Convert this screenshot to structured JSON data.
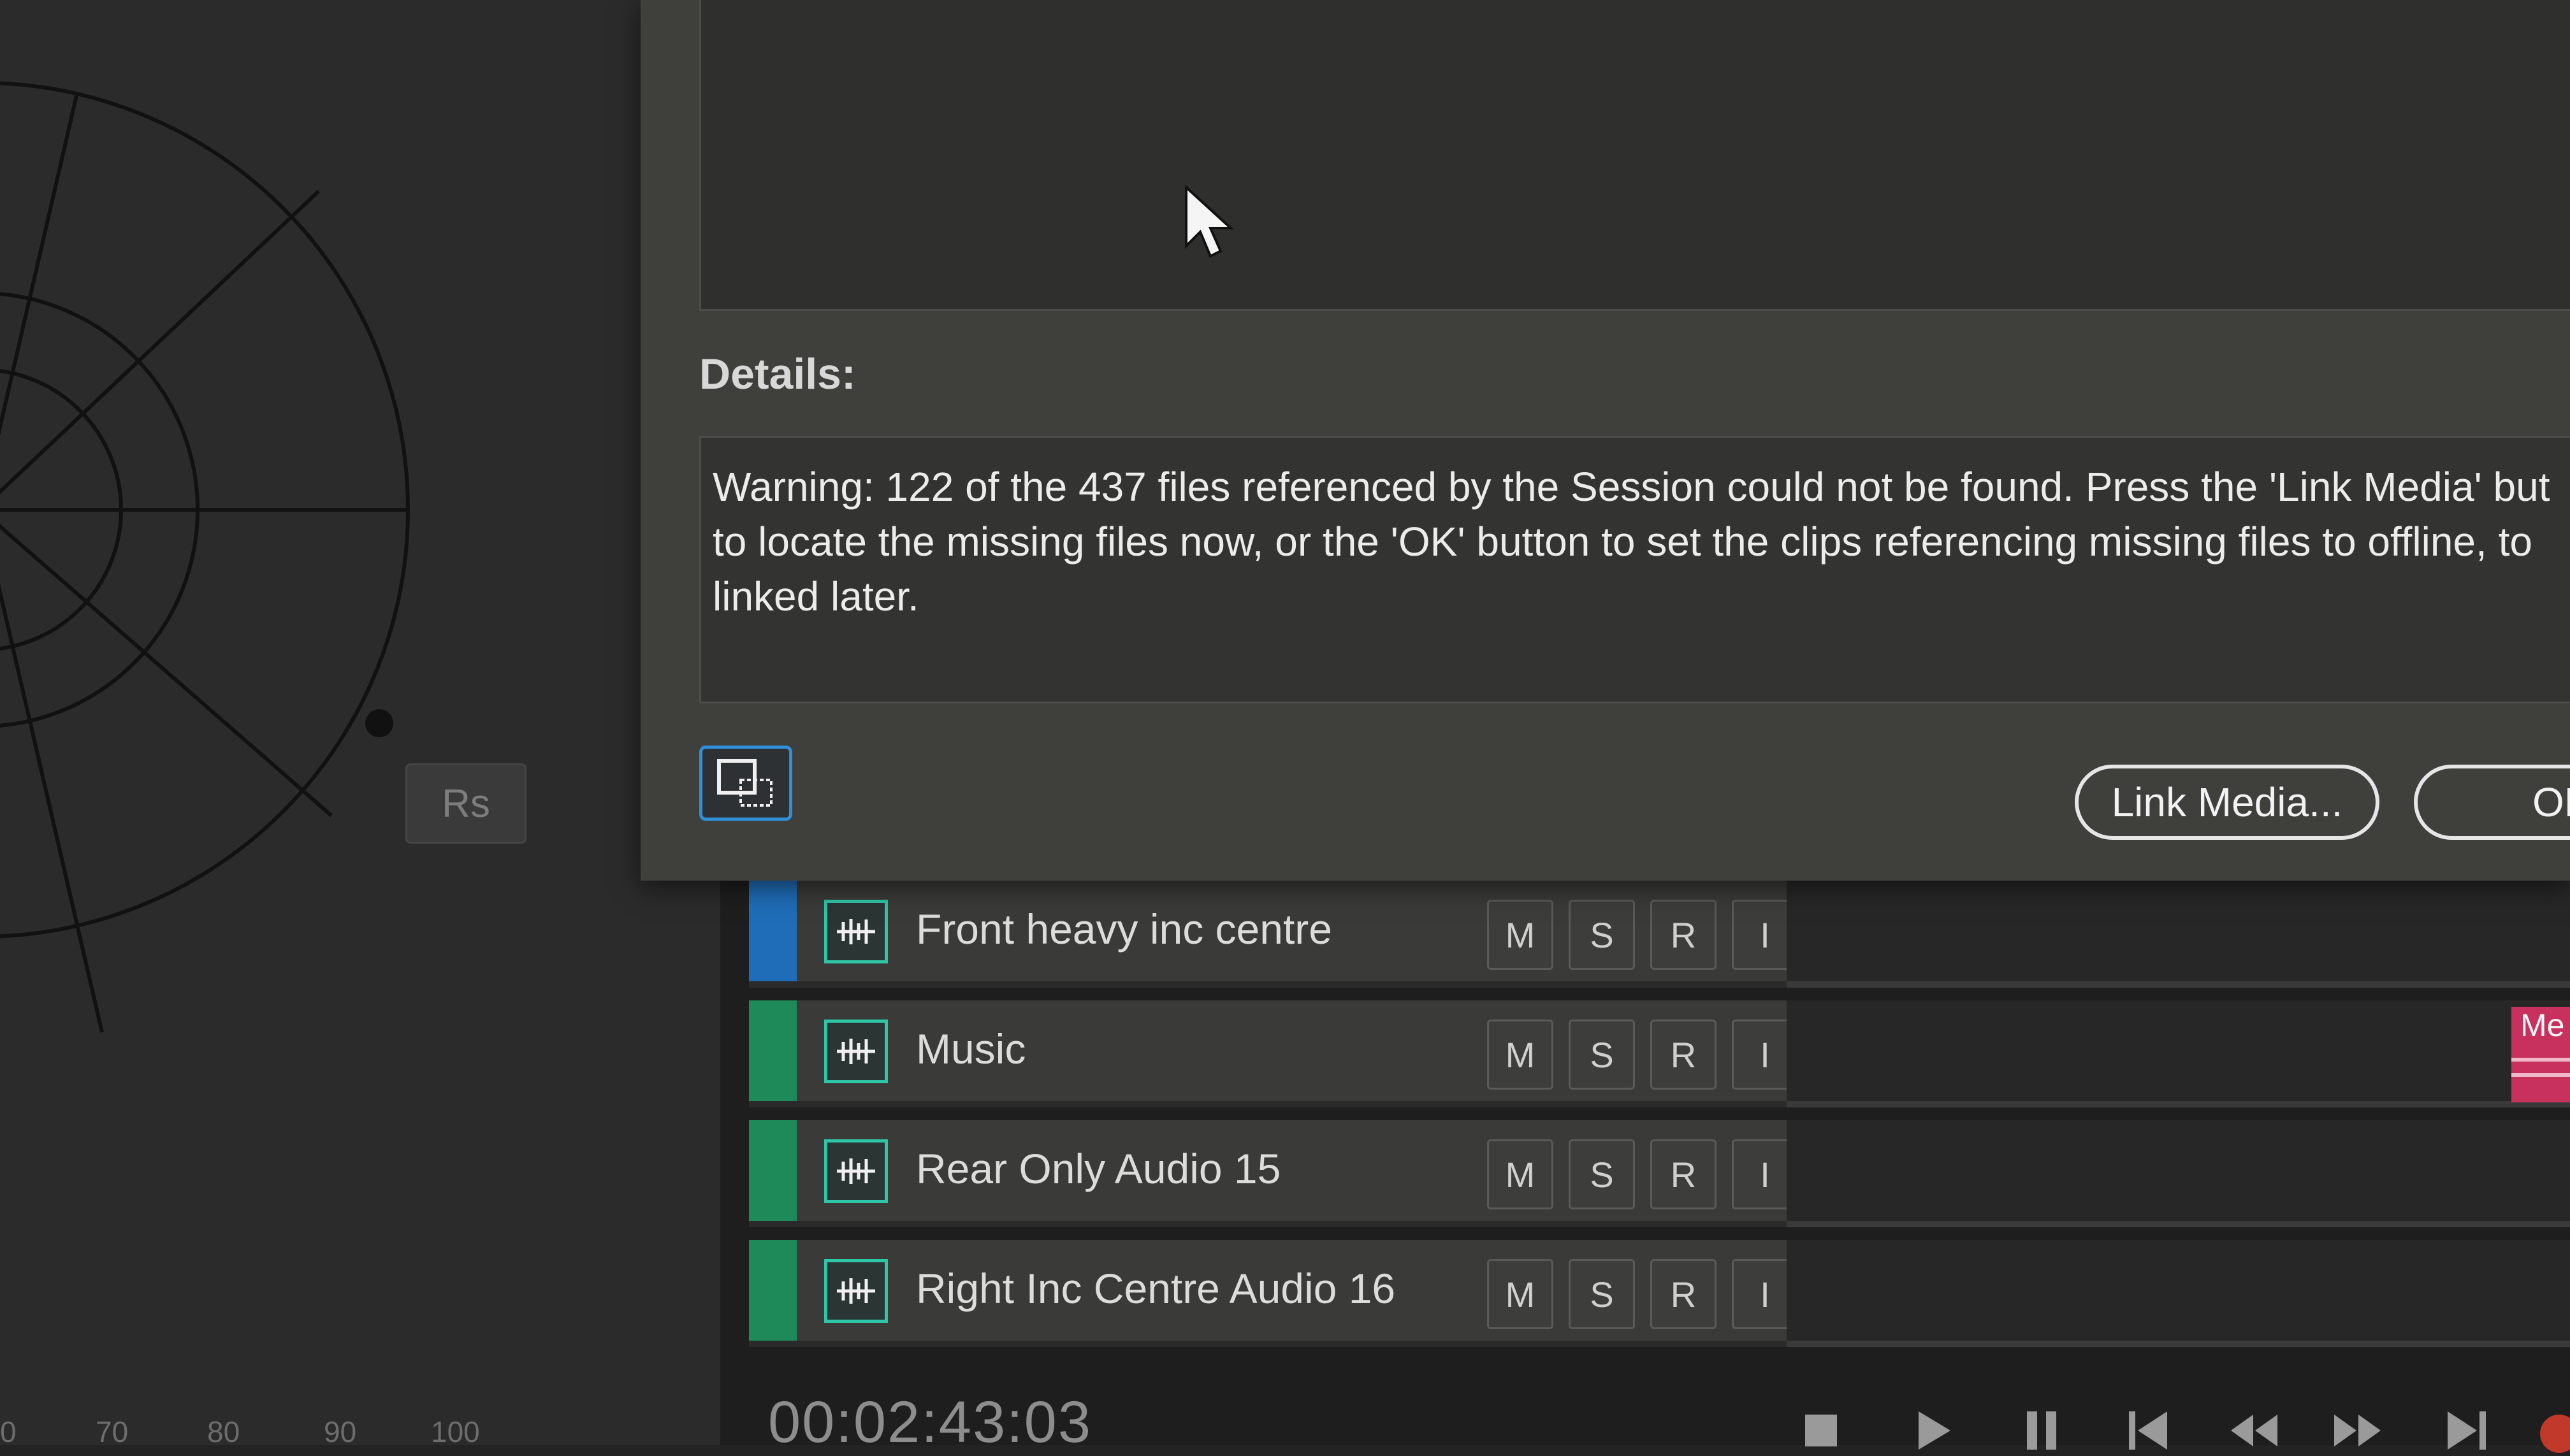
{
  "panner": {
    "rs_label": "Rs",
    "ruler_labels": [
      "0",
      "70",
      "80",
      "90",
      "100"
    ]
  },
  "dialog": {
    "details_label": "Details:",
    "details_lines": [
      "Warning: 122 of the 437 files referenced by the Session could not be found. Press the 'Link Media' but",
      "to locate the missing files now, or the 'OK' button to set the clips referencing missing files to offline, to",
      "linked later."
    ],
    "link_media_label": "Link Media...",
    "ok_label": "OK"
  },
  "tracks": [
    {
      "name": "Front heavy inc centre",
      "color": "#1f6db8",
      "buttons": [
        "M",
        "S",
        "R",
        "I"
      ]
    },
    {
      "name": "Music",
      "color": "#1e8a5a",
      "buttons": [
        "M",
        "S",
        "R",
        "I"
      ],
      "clip_label": "Me"
    },
    {
      "name": "Rear Only Audio 15",
      "color": "#1e8a5a",
      "buttons": [
        "M",
        "S",
        "R",
        "I"
      ]
    },
    {
      "name": "Right Inc Centre Audio 16",
      "color": "#1e8a5a",
      "buttons": [
        "M",
        "S",
        "R",
        "I"
      ]
    }
  ],
  "transport": {
    "timecode": "00:02:43:03",
    "icons": [
      "stop-icon",
      "play-icon",
      "pause-icon",
      "skip-to-start-icon",
      "rewind-icon",
      "fast-forward-icon",
      "skip-to-end-icon",
      "record-icon"
    ]
  },
  "colors": {
    "accent_blue": "#2f8fd8",
    "track_icon": "#2fc6a8",
    "clip": "#c8305e"
  }
}
